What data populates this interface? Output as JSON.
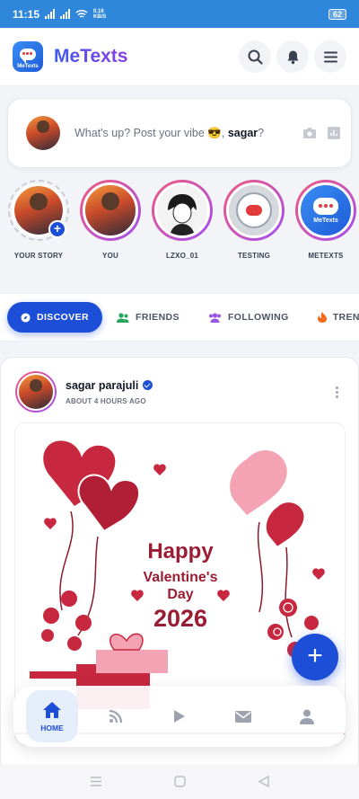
{
  "status_bar": {
    "time": "11:15",
    "net_speed": "0.16",
    "net_unit": "KB/S",
    "battery": "62"
  },
  "header": {
    "logo_text": "MeTexts",
    "brand": "MeTexts",
    "icons": [
      "search-icon",
      "bell-icon",
      "menu-icon"
    ]
  },
  "composer": {
    "prompt": "What's up? Post your vibe 😎, ",
    "username": "sagar",
    "suffix": "?",
    "icons": [
      "camera-icon",
      "chart-icon"
    ]
  },
  "stories": [
    {
      "label": "YOUR STORY"
    },
    {
      "label": "YOU"
    },
    {
      "label": "LZXO_01"
    },
    {
      "label": "TESTING"
    },
    {
      "label": "METEXTS"
    }
  ],
  "tabs": [
    {
      "label": "DISCOVER",
      "icon": "compass-icon",
      "active": true
    },
    {
      "label": "FRIENDS",
      "icon": "friends-icon"
    },
    {
      "label": "FOLLOWING",
      "icon": "following-icon"
    },
    {
      "label": "TRENDING",
      "icon": "fire-icon"
    }
  ],
  "post": {
    "author": "sagar parajuli",
    "time": "ABOUT 4 HOURS AGO",
    "image_text": {
      "line1": "Happy",
      "line2": "Valentine's",
      "line3": "Day",
      "line4": "2026"
    }
  },
  "fab": {
    "label": "+"
  },
  "bottom_nav": [
    {
      "label": "HOME",
      "icon": "home-icon",
      "active": true
    },
    {
      "label": "",
      "icon": "feed-icon"
    },
    {
      "label": "",
      "icon": "play-icon"
    },
    {
      "label": "",
      "icon": "mail-icon"
    },
    {
      "label": "",
      "icon": "user-icon"
    }
  ],
  "colors": {
    "accent": "#1d4ed8",
    "status_bar": "#2f87dc",
    "heart": "#c8283f",
    "brand_gradient_start": "#3f5bf0",
    "brand_gradient_end": "#8b3fe0"
  }
}
